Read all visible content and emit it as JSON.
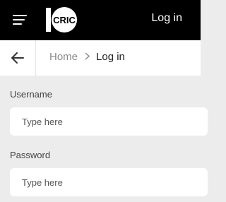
{
  "header": {
    "menu_icon": "hamburger-menu-icon",
    "logo": {
      "number": "10",
      "text": "CRIC"
    },
    "login_label": "Log in"
  },
  "breadcrumb": {
    "back_icon": "arrow-left-icon",
    "home_label": "Home",
    "separator_icon": "chevron-right-icon",
    "current_label": "Log in"
  },
  "form": {
    "username": {
      "label": "Username",
      "placeholder": "Type here",
      "value": ""
    },
    "password": {
      "label": "Password",
      "placeholder": "Type here",
      "value": ""
    }
  },
  "colors": {
    "header_bg": "#000000",
    "page_bg": "#ececec",
    "field_bg": "#ffffff"
  }
}
